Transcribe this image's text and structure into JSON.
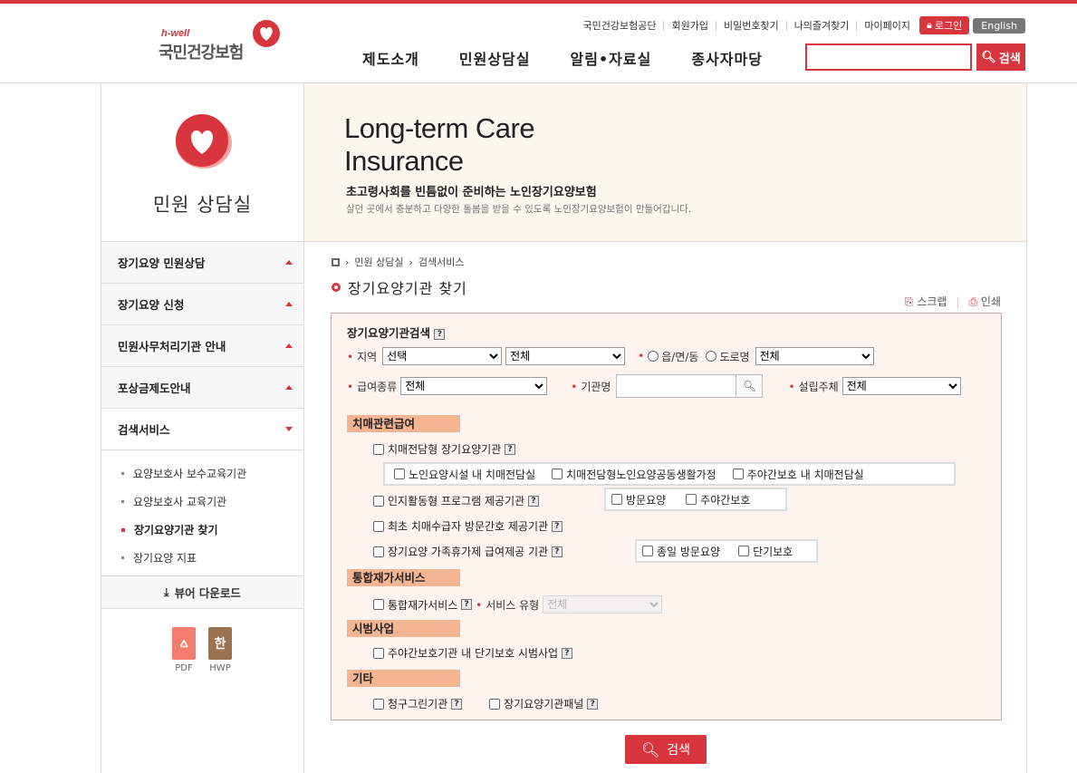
{
  "header": {
    "logo_sub": "h-well",
    "logo_name": "국민건강보험",
    "util_links": [
      "국민건강보험공단",
      "회원가입",
      "비밀번호찾기",
      "나의즐겨찾기",
      "마이페이지"
    ],
    "login": "로그인",
    "english": "English",
    "gnb": [
      "제도소개",
      "민원상담실",
      "알림•자료실",
      "종사자마당"
    ],
    "search_btn": "검색"
  },
  "lnb": {
    "title": "민원 상담실",
    "menu": [
      "장기요양 민원상담",
      "장기요양 신청",
      "민원사무처리기관 안내",
      "포상금제도안내",
      "검색서비스"
    ],
    "sub": [
      "요양보호사 보수교육기관",
      "요양보호사 교육기관",
      "장기요양기관 찾기",
      "장기요양 지표"
    ],
    "viewer": "뷰어 다운로드",
    "downloads": [
      "PDF",
      "HWP"
    ],
    "hwp_glyph": "한"
  },
  "banner": {
    "en_line1": "Long-term Care",
    "en_line2": "Insurance",
    "sub1": "초고령사회를 빈틈없이 준비하는 노인장기요양보험",
    "sub2": "살던 곳에서 충분하고 다양한 돌봄을 받을 수 있도록 노인장기요양보험이 만들어갑니다."
  },
  "content": {
    "breadcrumb": [
      "민원 상담실",
      "검색서비스"
    ],
    "page_title": "장기요양기관 찾기",
    "tools": [
      "스크랩",
      "인쇄"
    ],
    "panel_title": "장기요양기관검색",
    "help": "?",
    "region_label": "지역",
    "region1": "선택",
    "region2": "전체",
    "radio1": "읍/면/동",
    "radio2": "도로명",
    "region3": "전체",
    "benefit_label": "급여종류",
    "benefit": "전체",
    "name_label": "기관명",
    "founder_label": "설립주체",
    "founder": "전체",
    "sec1": "치매관련급여",
    "c1": "치매전담형 장기요양기관",
    "c1a": "노인요양시설 내 치매전담실",
    "c1b": "치매전담형노인요양공동생활가정",
    "c1c": "주야간보호 내 치매전담실",
    "c2": "인지활동형 프로그램 제공기관",
    "c2a": "방문요양",
    "c2b": "주야간보호",
    "c3": "최초 치매수급자 방문간호 제공기관",
    "c4": "장기요양 가족휴가제 급여제공 기관",
    "c4a": "종일 방문요양",
    "c4b": "단기보호",
    "sec2": "통합재가서비스",
    "c5": "통합재가서비스",
    "svc_label": "서비스 유형",
    "svc": "전체",
    "sec3": "시범사업",
    "c6": "주야간보호기관 내 단기보호 시범사업",
    "sec4": "기타",
    "c7": "청구그린기관",
    "c8": "장기요양기관패널",
    "search": "검색"
  },
  "colors": {
    "accent": "#d9353f",
    "section": "#f4b592",
    "panel_bg": "#fdf3ef"
  }
}
